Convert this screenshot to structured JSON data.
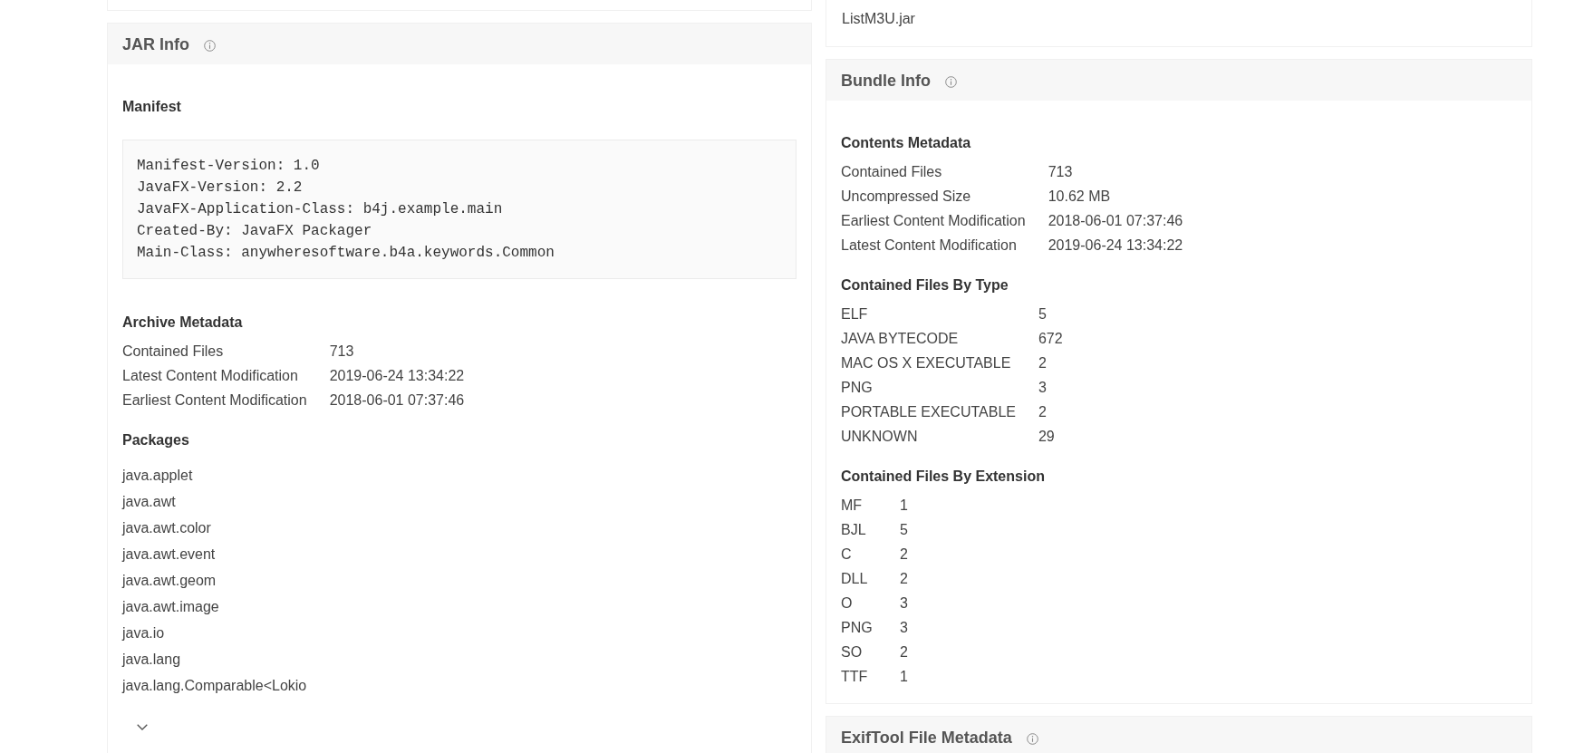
{
  "jar_info": {
    "title": "JAR Info",
    "sections": [
      {
        "kind": "code",
        "title": "Manifest",
        "lines": [
          "Manifest-Version: 1.0",
          "JavaFX-Version: 2.2",
          "JavaFX-Application-Class: b4j.example.main",
          "Created-By: JavaFX Packager",
          "Main-Class: anywheresoftware.b4a.keywords.Common"
        ]
      },
      {
        "kind": "table",
        "title": "Archive Metadata",
        "rows": [
          {
            "label": "Contained Files",
            "value": "713"
          },
          {
            "label": "Latest Content Modification",
            "value": "2019-06-24 13:34:22"
          },
          {
            "label": "Earliest Content Modification",
            "value": "2018-06-01 07:37:46"
          }
        ]
      },
      {
        "kind": "list",
        "title": "Packages",
        "items": [
          "java.applet",
          "java.awt",
          "java.awt.color",
          "java.awt.event",
          "java.awt.geom",
          "java.awt.image",
          "java.io",
          "java.lang",
          "java.lang.Comparable<Lokio"
        ],
        "expanded": false
      }
    ]
  },
  "file_card": {
    "lines": [
      "ListM3U.jar"
    ]
  },
  "bundle_info": {
    "title": "Bundle Info",
    "sections": [
      {
        "kind": "table",
        "title": "Contents Metadata",
        "rows": [
          {
            "label": "Contained Files",
            "value": "713"
          },
          {
            "label": "Uncompressed Size",
            "value": "10.62 MB"
          },
          {
            "label": "Earliest Content Modification",
            "value": "2018-06-01 07:37:46"
          },
          {
            "label": "Latest Content Modification",
            "value": "2019-06-24 13:34:22"
          }
        ]
      },
      {
        "kind": "table",
        "title": "Contained Files By Type",
        "rows": [
          {
            "label": "ELF",
            "value": "5"
          },
          {
            "label": "JAVA BYTECODE",
            "value": "672"
          },
          {
            "label": "MAC OS X EXECUTABLE",
            "value": "2"
          },
          {
            "label": "PNG",
            "value": "3"
          },
          {
            "label": "PORTABLE EXECUTABLE",
            "value": "2"
          },
          {
            "label": "UNKNOWN",
            "value": "29"
          }
        ]
      },
      {
        "kind": "table",
        "title": "Contained Files By Extension",
        "rows": [
          {
            "label": "MF",
            "value": "1"
          },
          {
            "label": "BJL",
            "value": "5"
          },
          {
            "label": "C",
            "value": "2"
          },
          {
            "label": "DLL",
            "value": "2"
          },
          {
            "label": "O",
            "value": "3"
          },
          {
            "label": "PNG",
            "value": "3"
          },
          {
            "label": "SO",
            "value": "2"
          },
          {
            "label": "TTF",
            "value": "1"
          }
        ]
      }
    ]
  },
  "exiftool_file_metadata": {
    "title": "ExifTool File Metadata"
  }
}
